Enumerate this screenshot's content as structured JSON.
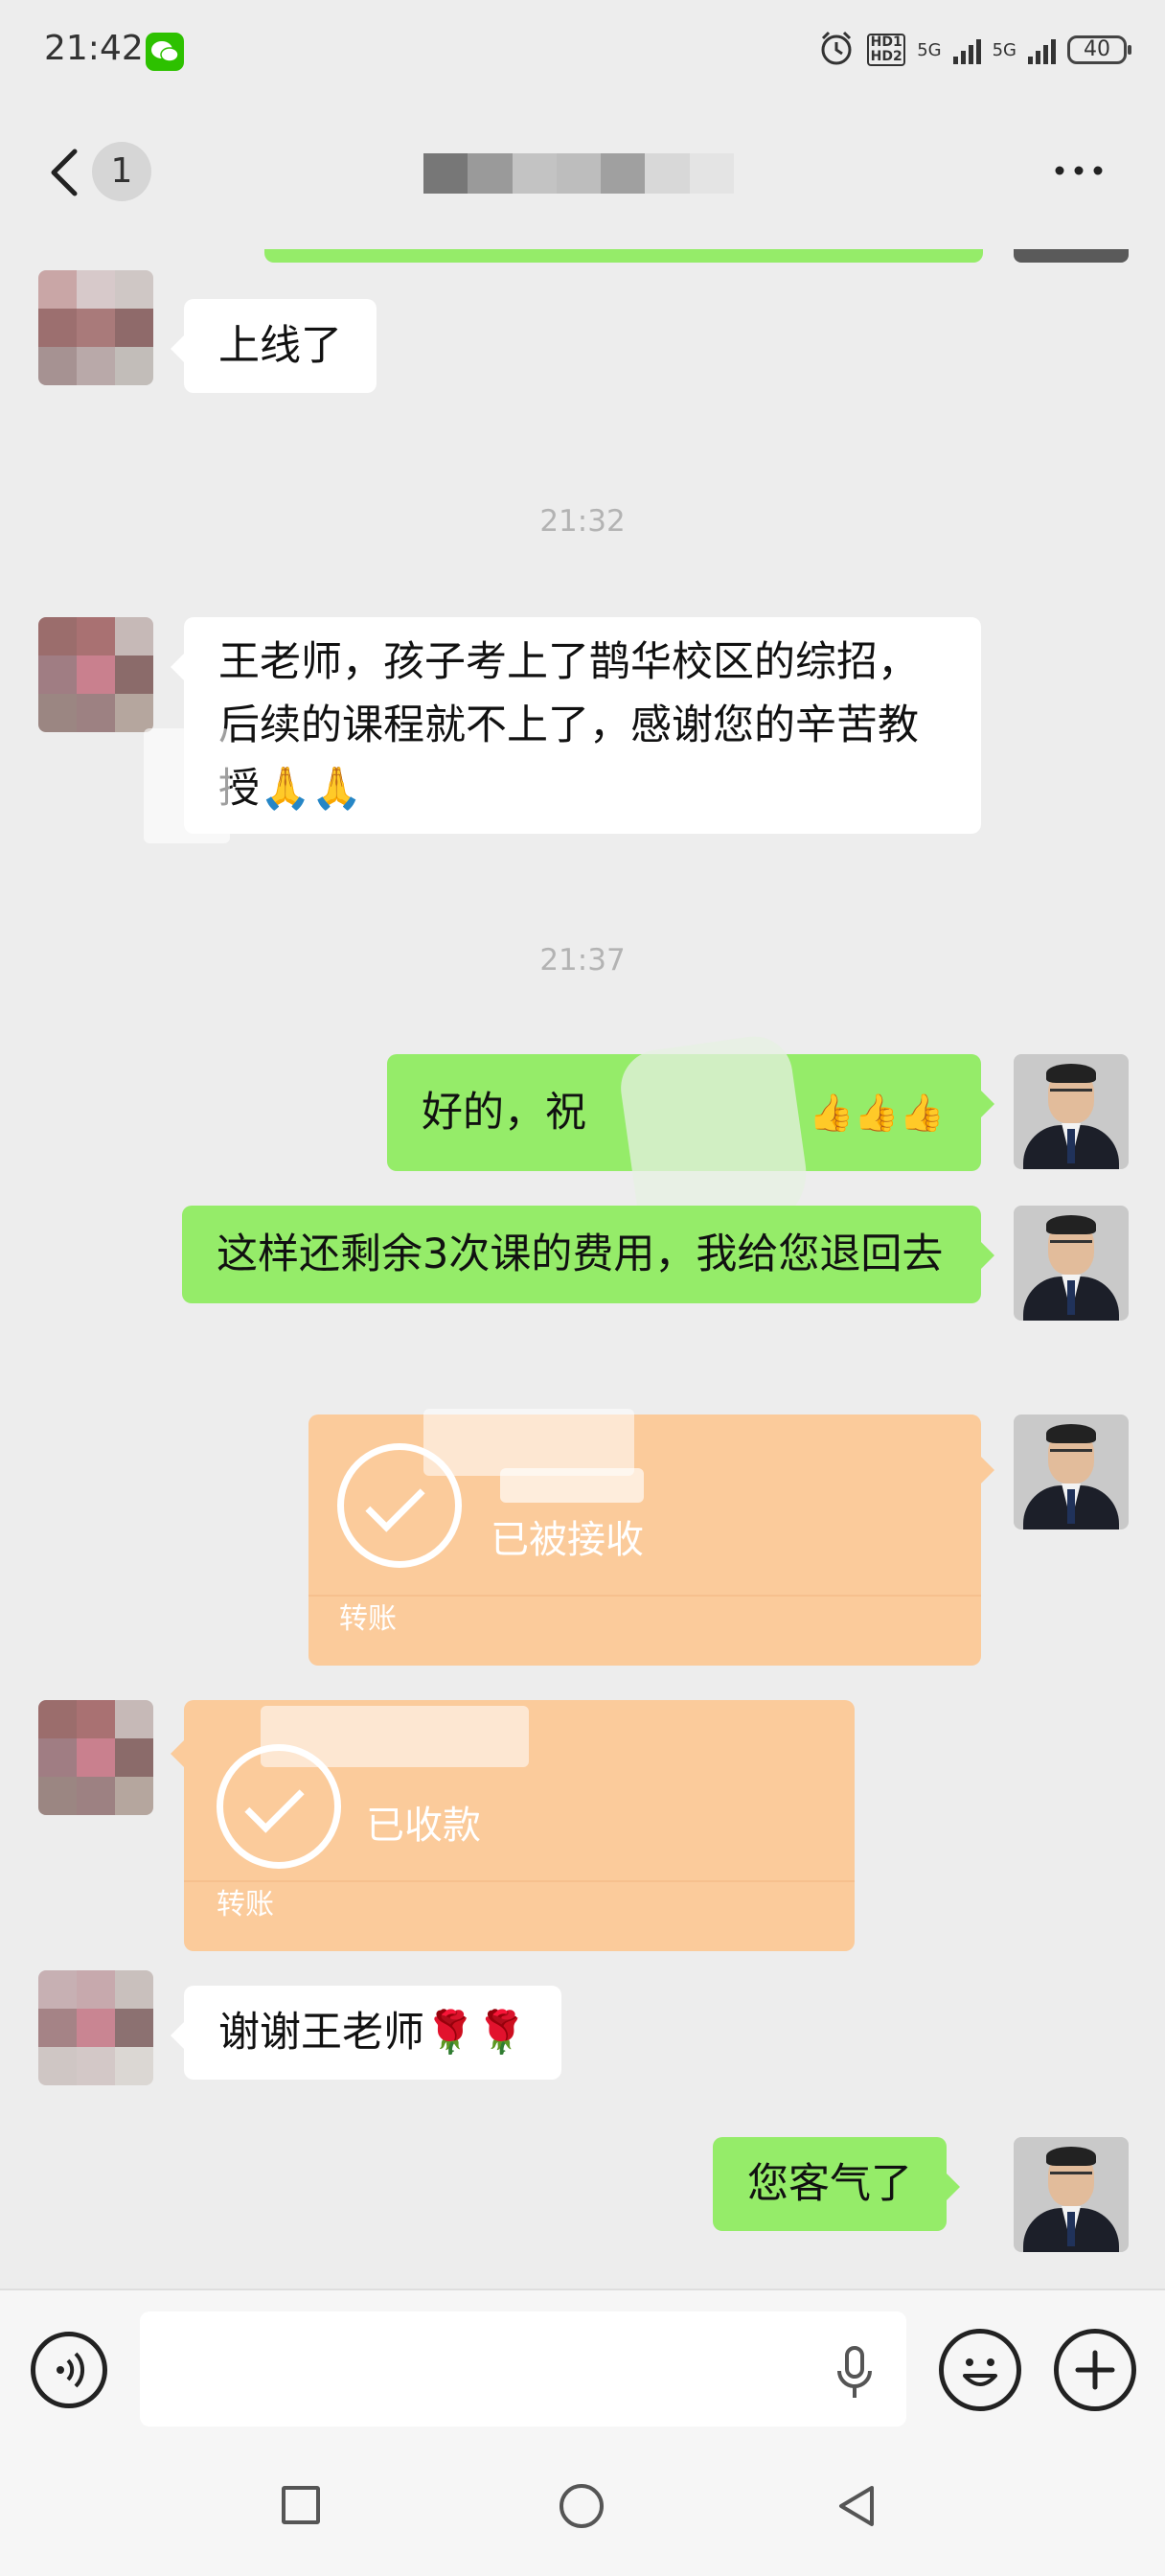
{
  "status_bar": {
    "time": "21:42",
    "hd_label": "HD1 HD2",
    "network_1": "5G",
    "network_2": "5G",
    "battery": "40"
  },
  "nav": {
    "unread_count": "1"
  },
  "messages": {
    "m1_text": "上线了",
    "ts1": "21:32",
    "m2_text": "王老师，孩子考上了鹊华校区的综招，后续的课程就不上了，感谢您的辛苦教授🙏🙏",
    "ts2": "21:37",
    "m3_text_start": "好的，祝",
    "m3_emojis": "👍👍👍",
    "m4_text": "这样还剩余3次课的费用，我给您退回去",
    "transfer1_status": "已被接收",
    "transfer1_label": "转账",
    "transfer2_status": "已收款",
    "transfer2_label": "转账",
    "m5_text": "谢谢王老师🌹🌹",
    "m6_text": "您客气了"
  },
  "colors": {
    "bubble_green": "#95ec69",
    "transfer_orange": "#fbcb9b",
    "background": "#ededed"
  }
}
